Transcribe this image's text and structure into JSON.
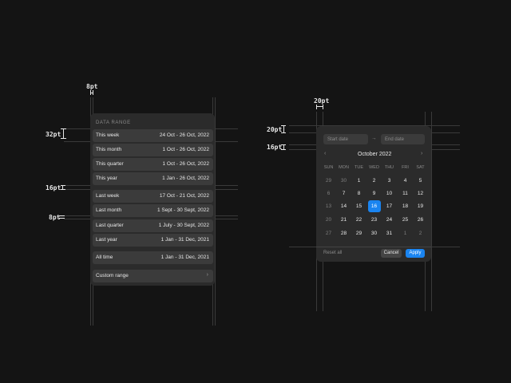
{
  "specs": {
    "left_top": "8pt",
    "left_32": "32pt",
    "left_16": "16pt",
    "left_8": "8pt",
    "right_top": "20pt",
    "right_20": "20pt",
    "right_16": "16pt"
  },
  "data_range": {
    "section_label": "DATA RANGE",
    "rows": [
      {
        "label": "This week",
        "value": "24 Oct - 26 Oct, 2022"
      },
      {
        "label": "This month",
        "value": "1 Oct - 26 Oct, 2022"
      },
      {
        "label": "This quarter",
        "value": "1 Oct - 26 Oct, 2022"
      },
      {
        "label": "This year",
        "value": "1 Jan - 26 Oct, 2022"
      },
      {
        "label": "Last week",
        "value": "17 Oct - 21 Oct, 2022"
      },
      {
        "label": "Last month",
        "value": "1 Sept - 30 Sept, 2022"
      },
      {
        "label": "Last quarter",
        "value": "1 July - 30 Sept, 2022"
      },
      {
        "label": "Last year",
        "value": "1 Jan - 31 Dec, 2021"
      },
      {
        "label": "All time",
        "value": "1 Jan - 31 Dec, 2021"
      }
    ],
    "custom_label": "Custom range",
    "custom_chevron": "›"
  },
  "calendar": {
    "start_placeholder": "Start date",
    "end_placeholder": "End date",
    "arrow": "→",
    "prev": "‹",
    "next": "›",
    "month": "October 2022",
    "weekdays": [
      "SUN",
      "MON",
      "TUE",
      "WED",
      "THU",
      "FRI",
      "SAT"
    ],
    "weeks": [
      [
        "29",
        "30",
        "1",
        "2",
        "3",
        "4",
        "5"
      ],
      [
        "6",
        "7",
        "8",
        "9",
        "10",
        "11",
        "12"
      ],
      [
        "13",
        "14",
        "15",
        "16",
        "17",
        "18",
        "19"
      ],
      [
        "20",
        "21",
        "22",
        "23",
        "24",
        "25",
        "26"
      ],
      [
        "27",
        "28",
        "29",
        "30",
        "31",
        "1",
        "2"
      ]
    ],
    "selected_day": "16",
    "reset_label": "Reset all",
    "cancel_label": "Cancel",
    "apply_label": "Apply",
    "accent": "#1a84f0"
  }
}
